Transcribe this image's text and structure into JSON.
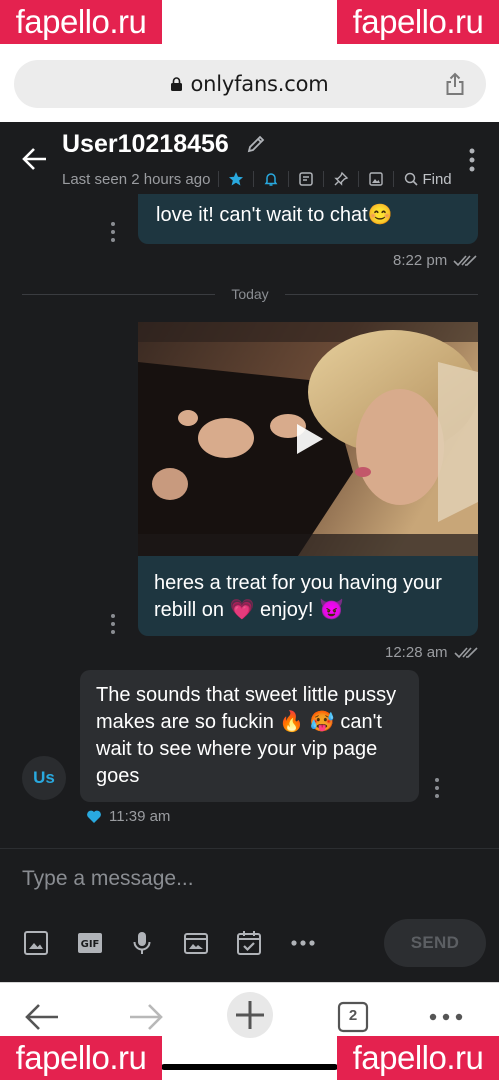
{
  "browser": {
    "url": "onlyfans.com"
  },
  "watermark": {
    "text": "fapello.ru"
  },
  "chat": {
    "user_name": "User10218456",
    "last_seen": "Last seen 2 hours ago",
    "find_label": "Find",
    "day_separator": "Today",
    "messages": [
      {
        "direction": "outgoing",
        "text": "video😊💗 I know you're gonna love it! can't wait to chat😊",
        "visible_text": "love it! can't wait to chat😊",
        "time": "8:22 pm"
      },
      {
        "direction": "outgoing",
        "type": "video",
        "text": "heres a treat for you having your rebill on 💗 enjoy! 😈",
        "time": "12:28 am"
      },
      {
        "direction": "incoming",
        "text": "The sounds that sweet little pussy makes are so fuckin 🔥 🥵 can't wait to see where your vip page goes",
        "time": "11:39 am",
        "liked": true
      }
    ],
    "avatar_initials": "Us",
    "composer": {
      "placeholder": "Type a message...",
      "send_label": "SEND"
    }
  },
  "bottom_nav": {
    "tab_count": "2"
  },
  "colors": {
    "background": "#1b1c1e",
    "outgoing_bubble": "#1e3640",
    "incoming_bubble": "#2c2e31",
    "accent": "#29a9df",
    "watermark": "#e4224f"
  }
}
